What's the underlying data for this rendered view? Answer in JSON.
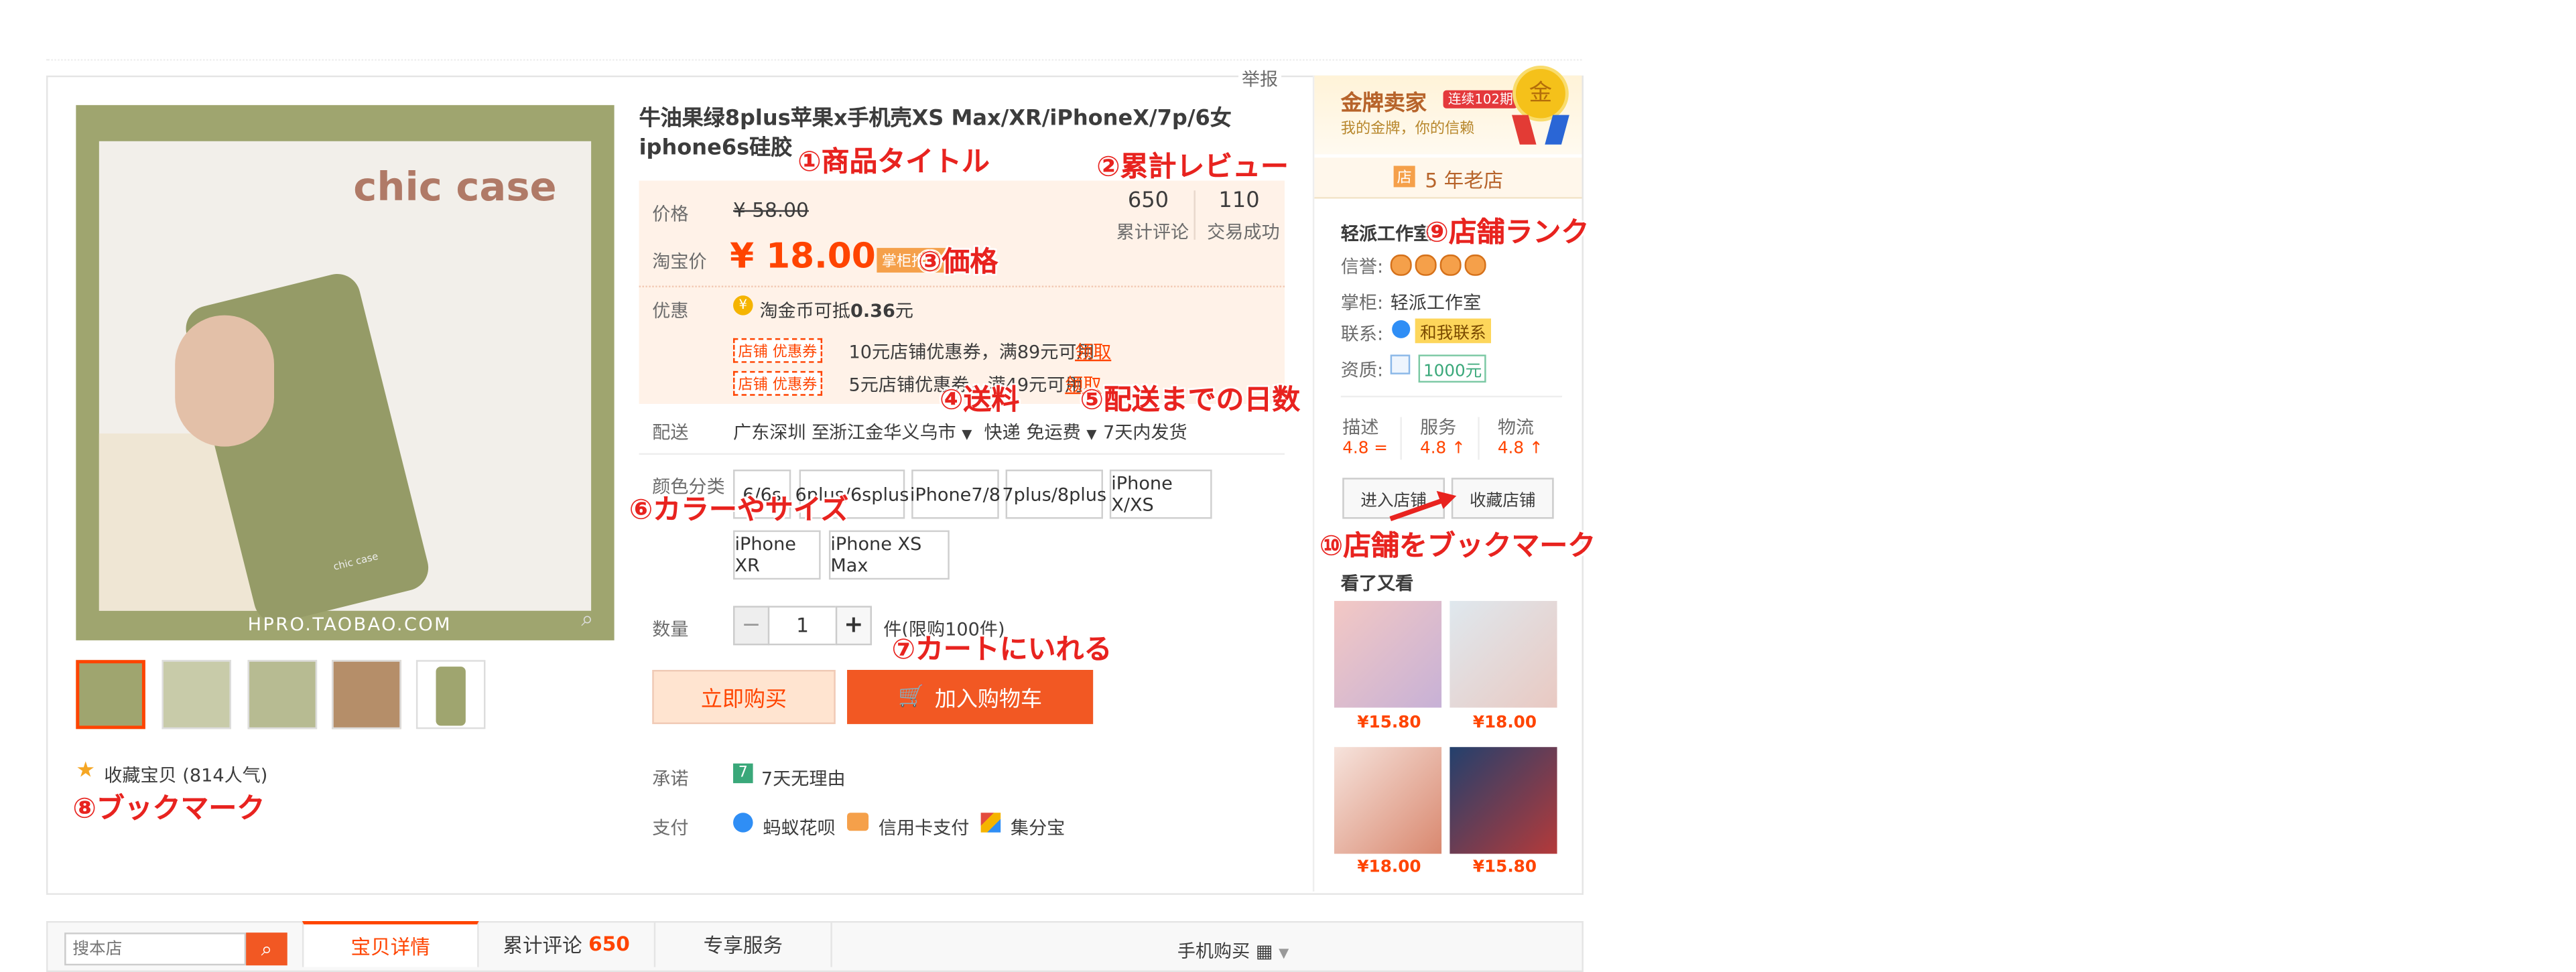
{
  "report_link": "举报",
  "product": {
    "title_line1": "牛油果绿8plus苹果x手机壳XS Max/XR/iPhoneX/7p/6女",
    "title_line2": "iphone6s硅胶",
    "image_brand_text": "chic case",
    "image_small_text": "chic case",
    "image_watermark": "HPRO.TAOBAO.COM",
    "thumbs_count": 5
  },
  "price": {
    "label_price": "价格",
    "original": "¥ 58.00",
    "label_taobao": "淘宝价",
    "current": "¥ 18.00",
    "badge": "掌柜推荐"
  },
  "stats": {
    "reviews_value": "650",
    "reviews_label": "累计评论",
    "deals_value": "110",
    "deals_label": "交易成功"
  },
  "promo": {
    "label": "优惠",
    "coin_text_pre": "淘金币可抵",
    "coin_amount": "0.36",
    "coin_text_post": "元",
    "coupon1_tag": "店铺 优惠券",
    "coupon1_text": "10元店铺优惠券，满89元可用",
    "coupon1_link": "领取",
    "coupon2_tag": "店铺 优惠券",
    "coupon2_text": "5元店铺优惠券，满49元可用",
    "coupon2_link": "领取"
  },
  "delivery": {
    "label": "配送",
    "from_to": "广东深圳 至",
    "destination": "浙江金华义乌市",
    "shipping": "快递 免运费",
    "days": "7天内发货"
  },
  "sku": {
    "label": "颜色分类",
    "options_row1": [
      "6/6s",
      "6plus/6splus",
      "iPhone7/8",
      "7plus/8plus",
      "iPhone X/XS"
    ],
    "options_row2": [
      "iPhone XR",
      "iPhone XS Max"
    ]
  },
  "quantity": {
    "label": "数量",
    "value": "1",
    "minus": "−",
    "plus": "+",
    "stock_text": "件(限购100件)"
  },
  "actions": {
    "buy_now": "立即购买",
    "add_cart": "加入购物车"
  },
  "promise": {
    "label": "承诺",
    "badge": "7",
    "text": "7天无理由"
  },
  "payment": {
    "label": "支付",
    "methods": [
      "蚂蚁花呗",
      "信用卡支付",
      "集分宝"
    ]
  },
  "favorite": {
    "text": "收藏宝贝 (814人气)"
  },
  "shop": {
    "gold_title": "金牌卖家",
    "gold_badge": "连续102期",
    "gold_sub": "我的金牌，你的信赖",
    "medal_char": "金",
    "years_icon": "店",
    "years_text": "5 年老店",
    "name": "轻派工作室",
    "credit_label": "信誉:",
    "keeper_label": "掌柜:",
    "keeper_value": "轻派工作室",
    "contact_label": "联系:",
    "contact_text": "和我联系",
    "qual_label": "资质:",
    "qual_value": "1000元",
    "scores": [
      {
        "label": "描述",
        "value": "4.8 ="
      },
      {
        "label": "服务",
        "value": "4.8 ↑"
      },
      {
        "label": "物流",
        "value": "4.8 ↑"
      }
    ],
    "enter_button": "进入店铺",
    "favorite_button": "收藏店铺",
    "related_title": "看了又看",
    "related_prices": [
      "¥15.80",
      "¥18.00",
      "¥18.00",
      "¥15.80"
    ]
  },
  "bottom_bar": {
    "search_placeholder": "搜本店",
    "tab_details": "宝贝详情",
    "tab_reviews": "累计评论",
    "tab_reviews_count": "650",
    "tab_service": "专享服务",
    "mobile_buy": "手机购买"
  },
  "annotations": {
    "a1": "①商品タイトル",
    "a2": "②累計レビュー",
    "a3": "③価格",
    "a4": "④送料",
    "a5": "⑤配送までの日数",
    "a6": "⑥カラーやサイズ",
    "a7": "⑦カートにいれる",
    "a8": "⑧ブックマーク",
    "a9": "⑨店舗ランク",
    "a10": "⑩店舗をブックマーク"
  },
  "colors": {
    "accent": "#f40",
    "buy_bg": "#ffeded",
    "cart_bg": "#f25823",
    "annotation": "#e8231f",
    "product_bg": "#99a06f"
  }
}
